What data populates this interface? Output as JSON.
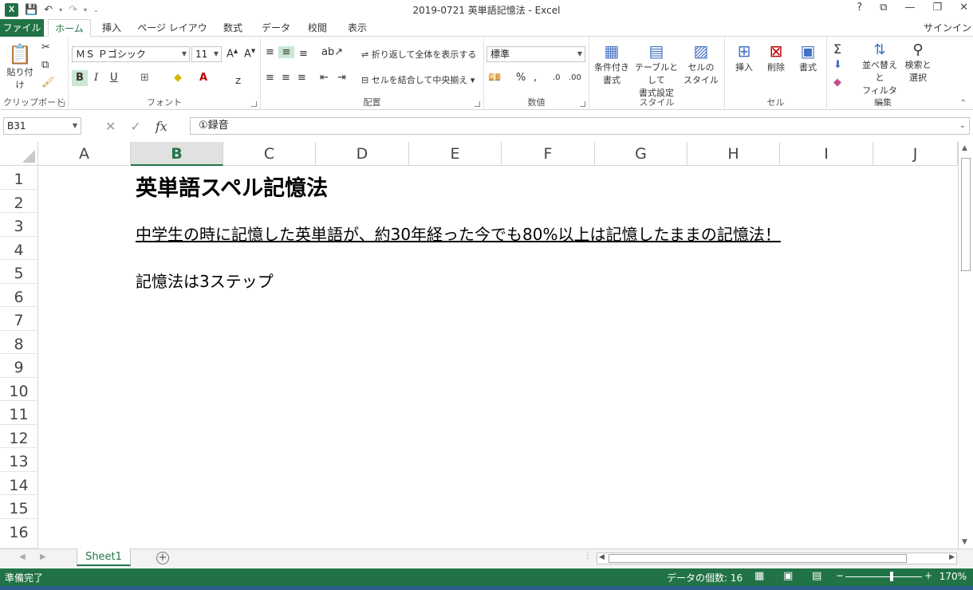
{
  "window": {
    "title": "2019-0721 英単語記憶法 - Excel",
    "controls": [
      "?",
      "⧉",
      "—",
      "❐",
      "✕"
    ]
  },
  "tabs": {
    "file": "ファイル",
    "items": [
      "ホーム",
      "挿入",
      "ページ レイアウト",
      "数式",
      "データ",
      "校閲",
      "表示"
    ],
    "active": "ホーム",
    "signin": "サインイン"
  },
  "ribbon": {
    "clipboard": {
      "paste": "貼り付け",
      "label": "クリップボード"
    },
    "font": {
      "name": "ＭＳ Ｐゴシック",
      "size": "11",
      "bold": "B",
      "italic": "I",
      "underline": "U",
      "label": "フォント"
    },
    "alignment": {
      "wrap": "折り返して全体を表示する",
      "merge": "セルを結合して中央揃え",
      "label": "配置"
    },
    "number": {
      "format": "標準",
      "percent": "%",
      "comma": ",",
      "label": "数値"
    },
    "styles": {
      "conditional": [
        "条件付き",
        "書式"
      ],
      "table": [
        "テーブルとして",
        "書式設定"
      ],
      "cell": [
        "セルの",
        "スタイル"
      ],
      "label": "スタイル"
    },
    "cells": {
      "insert": "挿入",
      "delete": "削除",
      "format": "書式",
      "label": "セル"
    },
    "editing": {
      "sort": [
        "並べ替えと",
        "フィルター"
      ],
      "find": [
        "検索と",
        "選択"
      ],
      "label": "編集"
    }
  },
  "formula_bar": {
    "name_box": "B31",
    "fx": "fx",
    "content": "①録音"
  },
  "grid": {
    "columns": [
      "A",
      "B",
      "C",
      "D",
      "E",
      "F",
      "G",
      "H",
      "I",
      "J"
    ],
    "selected_column": "B",
    "rows": [
      "1",
      "2",
      "3",
      "4",
      "5",
      "6",
      "7",
      "8",
      "9",
      "10",
      "11",
      "12",
      "13",
      "14",
      "15",
      "16"
    ],
    "cells": {
      "B1": "英単語スペル記憶法",
      "B3": "中学生の時に記憶した英単語が、約30年経った今でも80%以上は記憶したままの記憶法！",
      "B5": "記憶法は3ステップ"
    }
  },
  "sheets": {
    "tabs": [
      "Sheet1"
    ],
    "active": "Sheet1",
    "add": "+"
  },
  "status": {
    "ready": "準備完了",
    "count": "データの個数: 16",
    "zoom": "170%",
    "minus": "−",
    "plus": "+"
  },
  "colors": {
    "excel_green": "#217346",
    "status_bar": "#217346"
  }
}
